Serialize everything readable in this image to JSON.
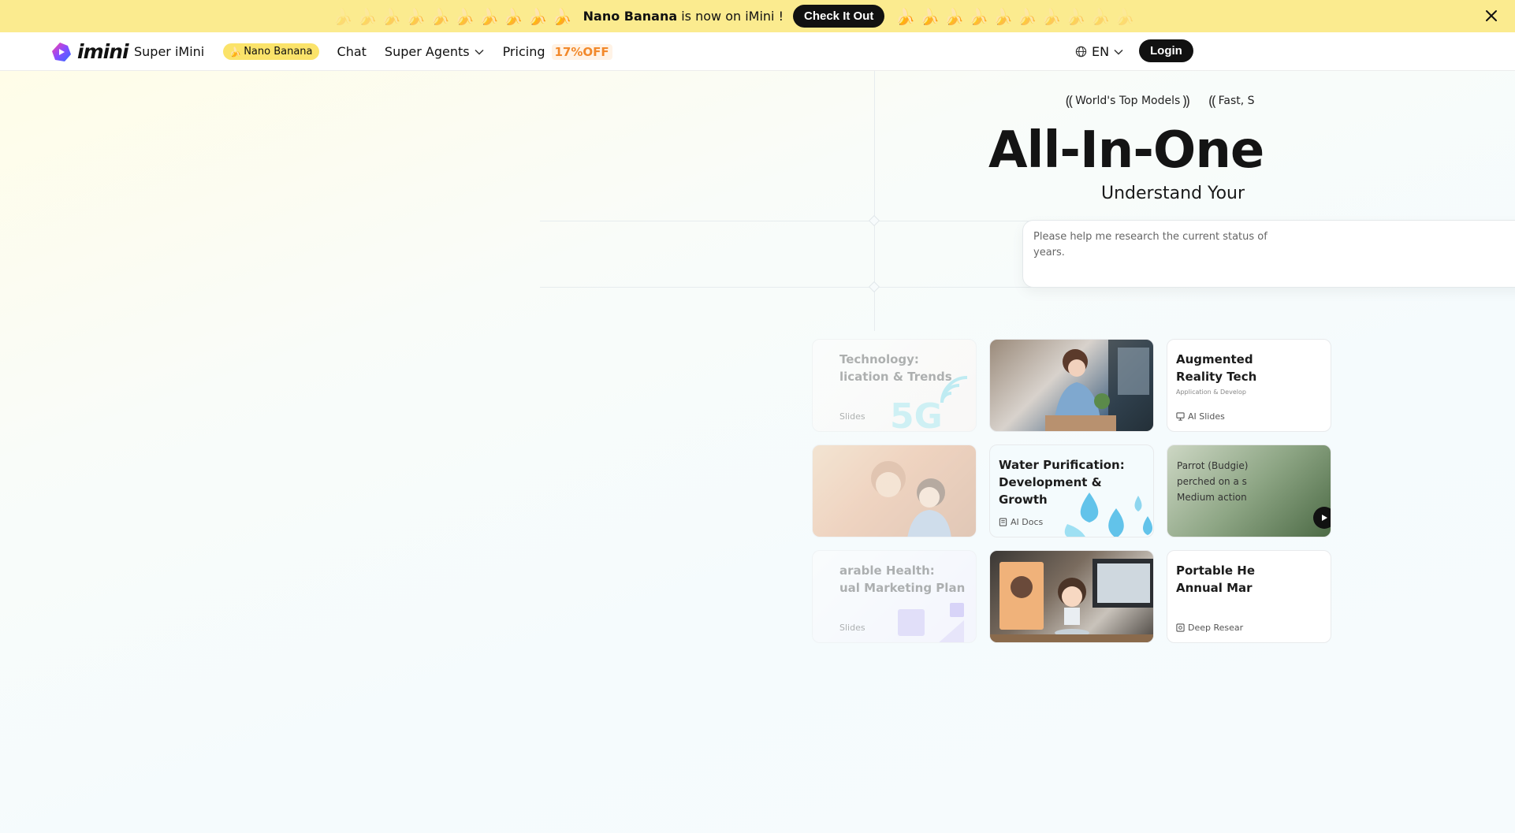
{
  "banner": {
    "brand": "Nano Banana",
    "text": "is now on iMini !",
    "cta": "Check It Out",
    "banana": "🍌"
  },
  "nav": {
    "logo": "imini",
    "items": {
      "super_imini": "Super iMini",
      "nano_banana": "Nano Banana",
      "chat": "Chat",
      "super_agents": "Super Agents",
      "pricing": "Pricing",
      "discount": "17%OFF"
    },
    "language": "EN",
    "login": "Login"
  },
  "hero": {
    "badges": [
      "World's Top Models",
      "Fast, S"
    ],
    "headline": "All-In-One",
    "subline": "Understand Your",
    "prompt_text": "Please help me research the current status of",
    "prompt_text_2": "years."
  },
  "cards": {
    "tech": {
      "title_1": "Technology:",
      "title_2": "lication & Trends",
      "tag": "Slides",
      "graphic": "5G"
    },
    "ar": {
      "title_1": "Augmented",
      "title_2": "Reality Tech",
      "sub": "Application & Develop",
      "tag": "AI Slides"
    },
    "water": {
      "title_1": "Water Purification:",
      "title_2": "Development & Growth",
      "tag": "AI Docs"
    },
    "parrot": {
      "caption_1": "Parrot (Budgie)",
      "caption_2": "perched on a s",
      "caption_3": "Medium action"
    },
    "wearable": {
      "title_1": "arable Health:",
      "title_2": "ual Marketing Plan",
      "tag": "Slides"
    },
    "portable": {
      "title_1": "Portable He",
      "title_2": "Annual Mar",
      "tag": "Deep Resear"
    }
  },
  "colors": {
    "banner_bg": "#fbeb8f",
    "nav_pill": "#fbe36a",
    "discount": "#f2892b",
    "button_dark": "#111111",
    "accent_blue": "#5bbfe8"
  }
}
